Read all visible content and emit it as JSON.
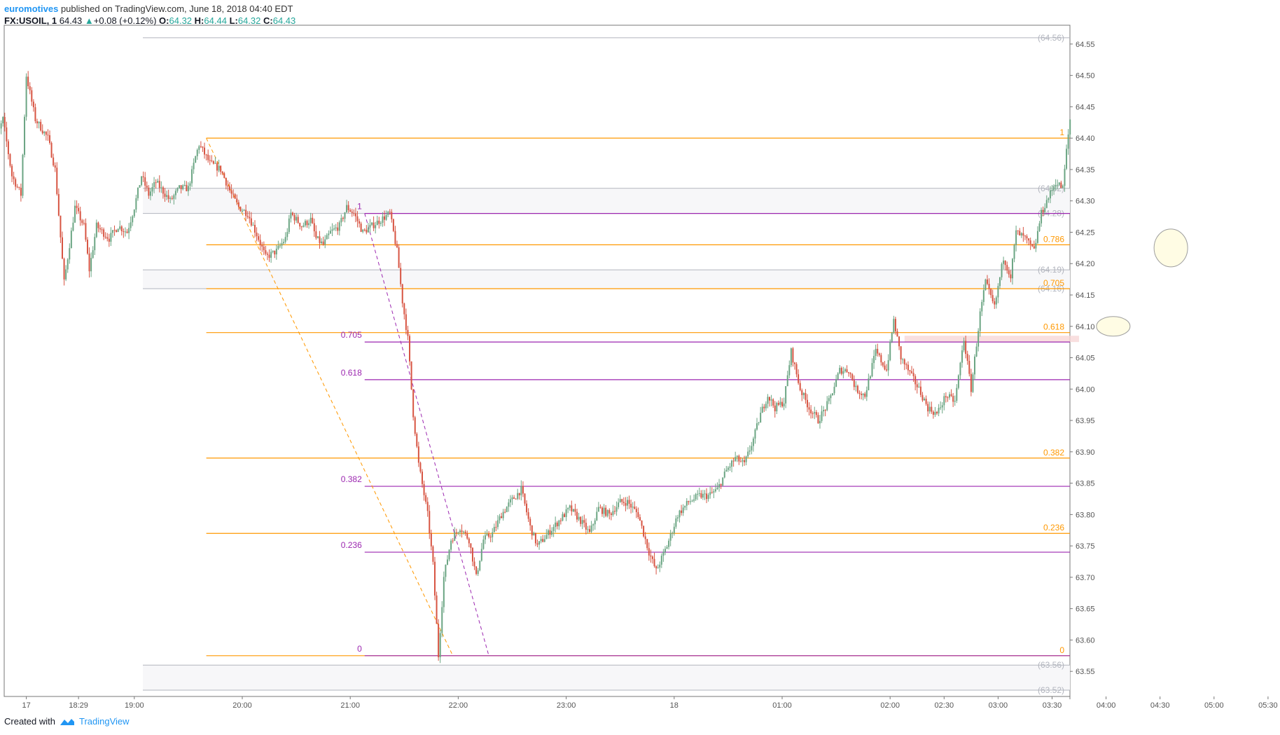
{
  "header": {
    "author": "euromotives",
    "published": "published on TradingView.com, June 18, 2018 04:40 EDT",
    "symbol": "FX:USOIL, 1",
    "last": "64.43",
    "change": "+0.08 (+0.12%)",
    "o_label": "O:",
    "o": "64.32",
    "h_label": "H:",
    "h": "64.44",
    "l_label": "L:",
    "l": "64.32",
    "c_label": "C:",
    "c": "64.43"
  },
  "footer": {
    "created": "Created with",
    "brand": "TradingView"
  },
  "colors": {
    "up": "#6ba583",
    "down": "#d75442",
    "fib_orange": "#ff9800",
    "fib_purple": "#9c27b0",
    "price_line": "#b2b5be"
  },
  "chart_data": {
    "type": "candlestick",
    "ylim": [
      63.51,
      64.58
    ],
    "yticks": [
      "64.55",
      "64.50",
      "64.45",
      "64.40",
      "64.35",
      "64.30",
      "64.25",
      "64.20",
      "64.15",
      "64.10",
      "64.05",
      "64.00",
      "63.95",
      "63.90",
      "63.85",
      "63.80",
      "63.75",
      "63.70",
      "63.65",
      "63.60",
      "63.55"
    ],
    "xticks": [
      {
        "label": "17",
        "t": -120
      },
      {
        "label": "18:29",
        "t": -91
      },
      {
        "label": "19:00",
        "t": -60
      },
      {
        "label": "20:00",
        "t": 0
      },
      {
        "label": "21:00",
        "t": 60
      },
      {
        "label": "22:00",
        "t": 120
      },
      {
        "label": "23:00",
        "t": 180
      },
      {
        "label": "18",
        "t": 240
      },
      {
        "label": "01:00",
        "t": 300
      },
      {
        "label": "02:00",
        "t": 360
      },
      {
        "label": "02:30",
        "t": 390
      },
      {
        "label": "03:00",
        "t": 420
      },
      {
        "label": "03:30",
        "t": 450
      },
      {
        "label": "04:00",
        "t": 480
      },
      {
        "label": "04:30",
        "t": 510
      },
      {
        "label": "05:00",
        "t": 540
      },
      {
        "label": "05:30",
        "t": 570
      }
    ],
    "price_markers": [
      {
        "label": "(64.56)",
        "value": 64.56
      },
      {
        "label": "(64.32)",
        "value": 64.32
      },
      {
        "label": "(64.28)",
        "value": 64.28
      },
      {
        "label": "(64.19)",
        "value": 64.19
      },
      {
        "label": "(64.16)",
        "value": 64.16
      },
      {
        "label": "(63.56)",
        "value": 63.56
      },
      {
        "label": "(63.52)",
        "value": 63.52
      }
    ],
    "fib_orange": [
      {
        "label": "1",
        "value": 64.4
      },
      {
        "label": "0.786",
        "value": 64.23
      },
      {
        "label": "0.705",
        "value": 64.16
      },
      {
        "label": "0.618",
        "value": 64.09
      },
      {
        "label": "0.382",
        "value": 63.89
      },
      {
        "label": "0.236",
        "value": 63.77
      },
      {
        "label": "0",
        "value": 63.575
      }
    ],
    "fib_purple": [
      {
        "label": "1",
        "value": 64.28
      },
      {
        "label": "0.705",
        "value": 64.075
      },
      {
        "label": "0.618",
        "value": 64.015
      },
      {
        "label": "0.382",
        "value": 63.845
      },
      {
        "label": "0.236",
        "value": 63.74
      },
      {
        "label": "0",
        "value": 63.575
      }
    ],
    "fib_orange_start_t": -20,
    "fib_purple_start_t": 68,
    "trend_orange": [
      {
        "t": -20,
        "v": 64.4
      },
      {
        "t": 117,
        "v": 63.575
      }
    ],
    "trend_purple": [
      {
        "t": 68,
        "v": 64.28
      },
      {
        "t": 137,
        "v": 63.575
      }
    ],
    "zone": {
      "t1": 368,
      "t2": 465,
      "v1": 64.085,
      "v2": 64.075
    },
    "ellipses": [
      {
        "t": 484,
        "v": 64.1
      },
      {
        "t": 516,
        "v": 64.225
      }
    ],
    "t_start": -140,
    "t_end": 526,
    "anchors": [
      {
        "t": -140,
        "v": 64.37
      },
      {
        "t": -133,
        "v": 64.43
      },
      {
        "t": -128,
        "v": 64.34
      },
      {
        "t": -123,
        "v": 64.31
      },
      {
        "t": -120,
        "v": 64.5
      },
      {
        "t": -115,
        "v": 64.43
      },
      {
        "t": -108,
        "v": 64.4
      },
      {
        "t": -104,
        "v": 64.35
      },
      {
        "t": -99,
        "v": 64.17
      },
      {
        "t": -96,
        "v": 64.23
      },
      {
        "t": -93,
        "v": 64.29
      },
      {
        "t": -88,
        "v": 64.26
      },
      {
        "t": -85,
        "v": 64.19
      },
      {
        "t": -81,
        "v": 64.26
      },
      {
        "t": -74,
        "v": 64.24
      },
      {
        "t": -69,
        "v": 64.26
      },
      {
        "t": -64,
        "v": 64.25
      },
      {
        "t": -60,
        "v": 64.29
      },
      {
        "t": -56,
        "v": 64.34
      },
      {
        "t": -52,
        "v": 64.31
      },
      {
        "t": -48,
        "v": 64.33
      },
      {
        "t": -40,
        "v": 64.3
      },
      {
        "t": -35,
        "v": 64.32
      },
      {
        "t": -30,
        "v": 64.32
      },
      {
        "t": -26,
        "v": 64.37
      },
      {
        "t": -24,
        "v": 64.39
      },
      {
        "t": -18,
        "v": 64.36
      },
      {
        "t": -12,
        "v": 64.35
      },
      {
        "t": -6,
        "v": 64.31
      },
      {
        "t": -2,
        "v": 64.29
      },
      {
        "t": 3,
        "v": 64.28
      },
      {
        "t": 9,
        "v": 64.24
      },
      {
        "t": 13,
        "v": 64.21
      },
      {
        "t": 19,
        "v": 64.22
      },
      {
        "t": 24,
        "v": 64.24
      },
      {
        "t": 27,
        "v": 64.28
      },
      {
        "t": 33,
        "v": 64.26
      },
      {
        "t": 38,
        "v": 64.27
      },
      {
        "t": 41,
        "v": 64.24
      },
      {
        "t": 45,
        "v": 64.23
      },
      {
        "t": 49,
        "v": 64.25
      },
      {
        "t": 54,
        "v": 64.26
      },
      {
        "t": 58,
        "v": 64.29
      },
      {
        "t": 62,
        "v": 64.28
      },
      {
        "t": 67,
        "v": 64.25
      },
      {
        "t": 72,
        "v": 64.26
      },
      {
        "t": 77,
        "v": 64.27
      },
      {
        "t": 82,
        "v": 64.28
      },
      {
        "t": 86,
        "v": 64.22
      },
      {
        "t": 89,
        "v": 64.14
      },
      {
        "t": 92,
        "v": 64.08
      },
      {
        "t": 95,
        "v": 63.96
      },
      {
        "t": 98,
        "v": 63.88
      },
      {
        "t": 103,
        "v": 63.8
      },
      {
        "t": 106,
        "v": 63.72
      },
      {
        "t": 109,
        "v": 63.575
      },
      {
        "t": 112,
        "v": 63.7
      },
      {
        "t": 116,
        "v": 63.76
      },
      {
        "t": 121,
        "v": 63.78
      },
      {
        "t": 126,
        "v": 63.76
      },
      {
        "t": 130,
        "v": 63.7
      },
      {
        "t": 134,
        "v": 63.76
      },
      {
        "t": 139,
        "v": 63.77
      },
      {
        "t": 144,
        "v": 63.8
      },
      {
        "t": 149,
        "v": 63.82
      },
      {
        "t": 155,
        "v": 63.84
      },
      {
        "t": 160,
        "v": 63.78
      },
      {
        "t": 164,
        "v": 63.75
      },
      {
        "t": 170,
        "v": 63.77
      },
      {
        "t": 176,
        "v": 63.79
      },
      {
        "t": 182,
        "v": 63.81
      },
      {
        "t": 188,
        "v": 63.79
      },
      {
        "t": 193,
        "v": 63.77
      },
      {
        "t": 198,
        "v": 63.81
      },
      {
        "t": 204,
        "v": 63.8
      },
      {
        "t": 210,
        "v": 63.82
      },
      {
        "t": 214,
        "v": 63.82
      },
      {
        "t": 220,
        "v": 63.8
      },
      {
        "t": 226,
        "v": 63.74
      },
      {
        "t": 230,
        "v": 63.71
      },
      {
        "t": 236,
        "v": 63.75
      },
      {
        "t": 242,
        "v": 63.8
      },
      {
        "t": 248,
        "v": 63.82
      },
      {
        "t": 254,
        "v": 63.83
      },
      {
        "t": 259,
        "v": 63.83
      },
      {
        "t": 264,
        "v": 63.84
      },
      {
        "t": 269,
        "v": 63.87
      },
      {
        "t": 274,
        "v": 63.89
      },
      {
        "t": 279,
        "v": 63.88
      },
      {
        "t": 284,
        "v": 63.92
      },
      {
        "t": 288,
        "v": 63.96
      },
      {
        "t": 292,
        "v": 63.99
      },
      {
        "t": 296,
        "v": 63.97
      },
      {
        "t": 301,
        "v": 63.98
      },
      {
        "t": 305,
        "v": 64.06
      },
      {
        "t": 310,
        "v": 64.0
      },
      {
        "t": 315,
        "v": 63.97
      },
      {
        "t": 320,
        "v": 63.95
      },
      {
        "t": 326,
        "v": 63.98
      },
      {
        "t": 332,
        "v": 64.03
      },
      {
        "t": 337,
        "v": 64.03
      },
      {
        "t": 341,
        "v": 64.0
      },
      {
        "t": 346,
        "v": 63.99
      },
      {
        "t": 352,
        "v": 64.06
      },
      {
        "t": 358,
        "v": 64.03
      },
      {
        "t": 362,
        "v": 64.11
      },
      {
        "t": 366,
        "v": 64.05
      },
      {
        "t": 370,
        "v": 64.03
      },
      {
        "t": 376,
        "v": 64.0
      },
      {
        "t": 381,
        "v": 63.97
      },
      {
        "t": 386,
        "v": 63.96
      },
      {
        "t": 391,
        "v": 63.99
      },
      {
        "t": 396,
        "v": 63.98
      },
      {
        "t": 401,
        "v": 64.08
      },
      {
        "t": 405,
        "v": 64.0
      },
      {
        "t": 410,
        "v": 64.12
      },
      {
        "t": 413,
        "v": 64.17
      },
      {
        "t": 418,
        "v": 64.13
      },
      {
        "t": 423,
        "v": 64.21
      },
      {
        "t": 427,
        "v": 64.18
      },
      {
        "t": 430,
        "v": 64.25
      },
      {
        "t": 435,
        "v": 64.24
      },
      {
        "t": 440,
        "v": 64.22
      },
      {
        "t": 444,
        "v": 64.28
      },
      {
        "t": 447,
        "v": 64.3
      },
      {
        "t": 452,
        "v": 64.33
      },
      {
        "t": 456,
        "v": 64.32
      },
      {
        "t": 458,
        "v": 64.38
      },
      {
        "t": 460,
        "v": 64.43
      }
    ]
  }
}
